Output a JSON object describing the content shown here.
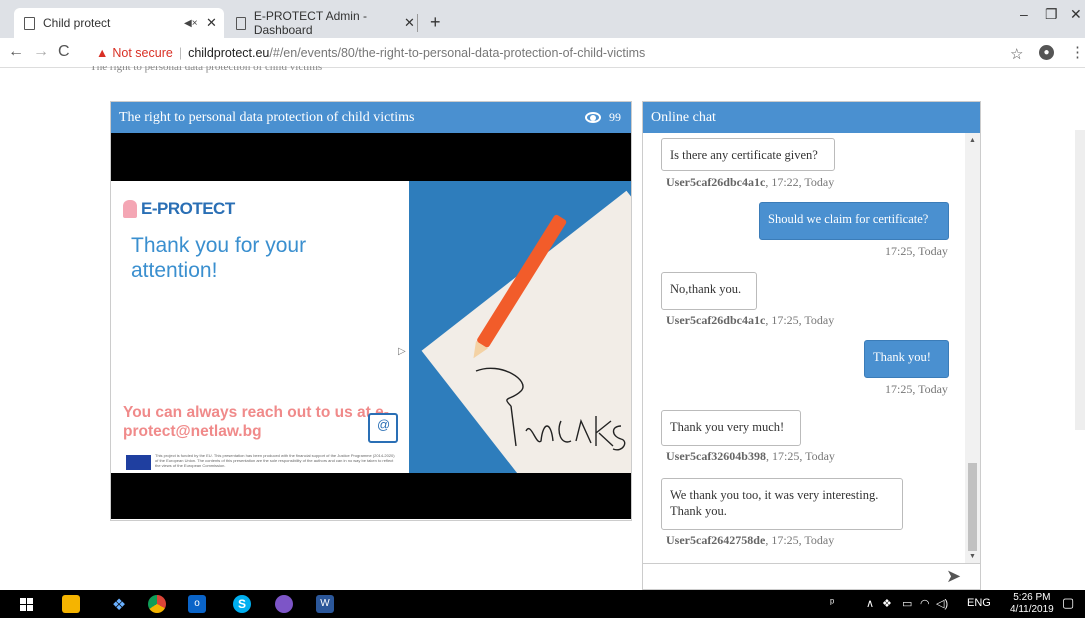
{
  "browser": {
    "tabs": [
      {
        "title": "Child protect"
      },
      {
        "title": "E-PROTECT Admin - Dashboard"
      }
    ],
    "address": {
      "security": "Not secure",
      "host": "childprotect.eu",
      "path": "/#/en/events/80/the-right-to-personal-data-protection-of-child-victims"
    }
  },
  "page": {
    "cut_heading": "The right to personal data protection of child victims",
    "video": {
      "title": "The right to personal data protection of child victims",
      "views": "99",
      "slide": {
        "brand": "E-PROTECT",
        "thanks": "Thank you for your attention!",
        "reach": "You can always reach out to us at e-protect@netlaw.bg",
        "fine_print": "This project is funded by the EU. This presentation has been produced with the financial support of the Justice Programme (2014-2020) of the European Union. The contents of this presentation are the sole responsibility of the authors and can in no way be taken to reflect the views of the European Commission."
      }
    },
    "chat": {
      "title": "Online chat",
      "messages": [
        {
          "text": "Is there any certificate given?",
          "meta_user": "User5caf26dbc4a1c",
          "meta_time": ", 17:22, Today"
        },
        {
          "text": "Should we claim for certificate?",
          "meta_time": "17:25, Today"
        },
        {
          "text": "No,thank you.",
          "meta_user": "User5caf26dbc4a1c",
          "meta_time": ", 17:25, Today"
        },
        {
          "text": "Thank you!",
          "meta_time": "17:25, Today"
        },
        {
          "text": "Thank you very much!",
          "meta_user": "User5caf32604b398",
          "meta_time": ", 17:25, Today"
        },
        {
          "text": "We thank you too, it was very interesting. Thank you.",
          "meta_user": "User5caf2642758de",
          "meta_time": ", 17:25, Today"
        }
      ]
    }
  },
  "taskbar": {
    "lang": "ENG",
    "time": "5:26 PM",
    "date": "4/11/2019"
  }
}
